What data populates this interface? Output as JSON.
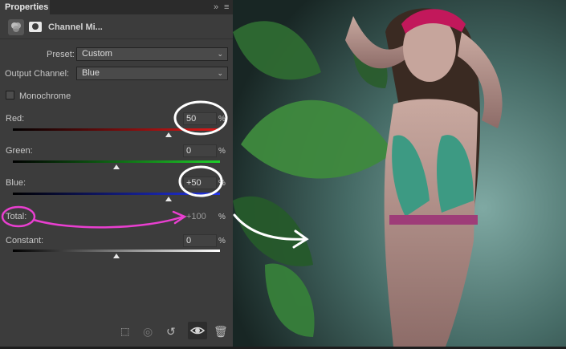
{
  "panel": {
    "tab_label": "Properties",
    "header_title": "Channel Mi...",
    "preset": {
      "label": "Preset:",
      "value": "Custom"
    },
    "output_channel": {
      "label": "Output Channel:",
      "value": "Blue"
    },
    "monochrome": {
      "label": "Monochrome",
      "checked": false
    },
    "sliders": [
      {
        "label": "Red:",
        "value": "50",
        "unit": "%",
        "level": 0.75
      },
      {
        "label": "Green:",
        "value": "0",
        "unit": "%",
        "level": 0.5
      },
      {
        "label": "Blue:",
        "value": "+50",
        "unit": "%",
        "level": 0.75
      }
    ],
    "total": {
      "label": "Total:",
      "value": "+100",
      "unit": "%"
    },
    "constant": {
      "label": "Constant:",
      "value": "0",
      "unit": "%",
      "level": 0.5
    }
  },
  "toolbar_icons": [
    "clip-to-layer-icon",
    "view-previous-icon",
    "reset-icon",
    "visibility-eye-icon",
    "trash-icon"
  ],
  "colors": {
    "panel_bg": "#3c3c3c",
    "annotation_white": "#ffffff",
    "annotation_magenta": "#e93fd0"
  }
}
